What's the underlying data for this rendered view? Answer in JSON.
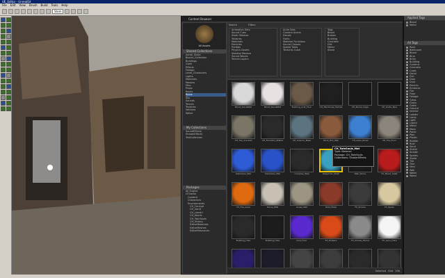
{
  "editor": {
    "title": "UE_Editor - UnrealEd",
    "menu": [
      "File",
      "Edit",
      "View",
      "Brush",
      "Build",
      "Tools",
      "Help"
    ],
    "zoom": "Stem"
  },
  "content_browser": {
    "title": "Content Browser",
    "all_assets_label": "All Assets",
    "shared_collections_title": "Shared Collections",
    "shared_collections": [
      "Aerial_Shots",
      "Blocks_Collection",
      "Buildings",
      "Cloth",
      "Effects",
      "Foliage",
      "Level_Characters",
      "Lights",
      "Materials",
      "Meshes",
      "Misc",
      "Props",
      "Rocks",
      "Ruins",
      "Sky",
      "Sounds",
      "Terrain",
      "Textures",
      "Vehicles",
      "Water"
    ],
    "selected_shared_collection": "Ruins",
    "my_collections_title": "My Collections",
    "my_collections": [
      "SoundEffects",
      "ShaderEffects",
      "TestCollection"
    ],
    "packages_title": "Packages",
    "packages": [
      "All Engine",
      "UTGame",
      "Content",
      "Characters",
      "Environments",
      "CH_Corrupt",
      "CH_IronG",
      "CH_Liandri",
      "CH_Necris",
      "CH_TwinSouls",
      "CH_Victory",
      "EditorMaterials",
      "EditorMeshes",
      "EditorResources"
    ],
    "search_label": "Search",
    "filters_label": "Filters",
    "filter_columns": [
      [
        "Animation Sets",
        "Sound Cues",
        "Static Meshes",
        "Textures",
        "Materials",
        "Particles",
        "Prefabs",
        "Physics Assets",
        "Skeletal Meshes",
        "Sound Waves",
        "Terrain Layers"
      ],
      [
        "Anim Sets",
        "Camera Anims",
        "Decals",
        "Fonts",
        "Material Functions",
        "Sound Classes",
        "Speed Trees",
        "Textures Cube"
      ],
      [
        "Tags",
        "Blood",
        "Broken",
        "Building",
        "Concrete",
        "Dirt",
        "Metal",
        "Stone"
      ]
    ],
    "status_right": [
      "Selected",
      "Grid",
      "256"
    ],
    "assets": [
      {
        "label": "Blood_DecalMat",
        "color": "#d9d9d9"
      },
      {
        "label": "Blood_DecalMat",
        "color": "#e8e1e1"
      },
      {
        "label": "Building_Grill_Floor",
        "color": "#6b5a48"
      },
      {
        "label": "CH_TwinSouls_Helmet",
        "color": "#1f1f1f"
      },
      {
        "label": "CH_Barrel_Cage",
        "color": "#191919"
      },
      {
        "label": "CH_Grate_Pipe",
        "color": "#141414"
      },
      {
        "label": "CH_Tile_Cracked",
        "color": "#7a7565"
      },
      {
        "label": "CH_Fountain_Statue",
        "color": "#2a2a2a"
      },
      {
        "label": "CH_Column_Base",
        "color": "#5c7480"
      },
      {
        "label": "Rock_Dirt_Mat",
        "color": "#8a5a3c"
      },
      {
        "label": "CH_Glow_Panel",
        "color": "#3d7fd0"
      },
      {
        "label": "CH_Tile_Floor",
        "color": "#8a847a"
      },
      {
        "label": "DarkGlow_Mat",
        "color": "#2e5bd6"
      },
      {
        "label": "DarkGlow_Mat",
        "color": "#2952c8"
      },
      {
        "label": "Complex_Wall",
        "color": "#2a2a2a"
      },
      {
        "label": "Teleporter_Mesh",
        "color": "#3aa0c0"
      },
      {
        "label": "Wall_Stone",
        "color": "#1c1c1c"
      },
      {
        "label": "FX_Blood_Splat",
        "color": "#b81c1c"
      },
      {
        "label": "FX_Fire_Glow",
        "color": "#e06a10"
      },
      {
        "label": "Stone_Wall",
        "color": "#c7c0b3"
      },
      {
        "label": "Grass_Mat",
        "color": "#9c9584"
      },
      {
        "label": "Rust_Plate",
        "color": "#8a3a28"
      },
      {
        "label": "FX_Smoke",
        "color": "#3b3b3b"
      },
      {
        "label": "FX_Spark",
        "color": "#d8c8a0"
      },
      {
        "label": "Building_Hole",
        "color": "#2a2a2a"
      },
      {
        "label": "Building_Hole",
        "color": "#1c1c1c"
      },
      {
        "label": "Grid_Floor",
        "color": "#5a2ad0"
      },
      {
        "label": "FX_Embers",
        "color": "#d84a18"
      },
      {
        "label": "FX_Smoke_Plume",
        "color": "#8a8a8a"
      },
      {
        "label": "FX_Lens_Flare",
        "color": "#f5f5f5"
      },
      {
        "label": "Electric_Arc",
        "color": "#2a1d6a"
      },
      {
        "label": "Dark_Fog",
        "color": "#1c1c2a"
      },
      {
        "label": "Pipe_Steel",
        "color": "#444444"
      },
      {
        "label": "Crate_Mesh",
        "color": "#3c3c3c"
      },
      {
        "label": "Column_Mesh",
        "color": "#2a2a2a"
      },
      {
        "label": "Torch_Mesh",
        "color": "#333333"
      }
    ],
    "selected_index": 15,
    "tooltip": {
      "title": "CH_TwinSouls_Mat",
      "lines": [
        "Type: Material",
        "Package: CH_TwinSouls",
        "Collections: ShaderEffects"
      ]
    }
  },
  "tags_panel": {
    "applied_title": "Applied Tags",
    "applied": [
      "Blood",
      "Metal"
    ],
    "all_title": "All Tags",
    "all": [
      "Rock",
      "Bathroom",
      "Blood",
      "Blue",
      "Brick",
      "Building",
      "Ceramic",
      "Concrete",
      "Crate",
      "Decal",
      "Dirt",
      "Door",
      "Dust",
      "Electric",
      "Emissive",
      "Fire",
      "Floor",
      "Foliage",
      "Glass",
      "Grass",
      "Grate",
      "Ground",
      "Interior",
      "Ladder",
      "Lamp",
      "Light",
      "Liquid",
      "Metal",
      "Moss",
      "Panel",
      "Pipe",
      "Plastic",
      "Rubble",
      "Rust",
      "Sand",
      "Shield",
      "Smoke",
      "Sparks",
      "Stone",
      "Tile",
      "Trim",
      "Vent",
      "Wall",
      "Water",
      "Wood"
    ],
    "checked": [
      "Blood",
      "Metal"
    ]
  }
}
